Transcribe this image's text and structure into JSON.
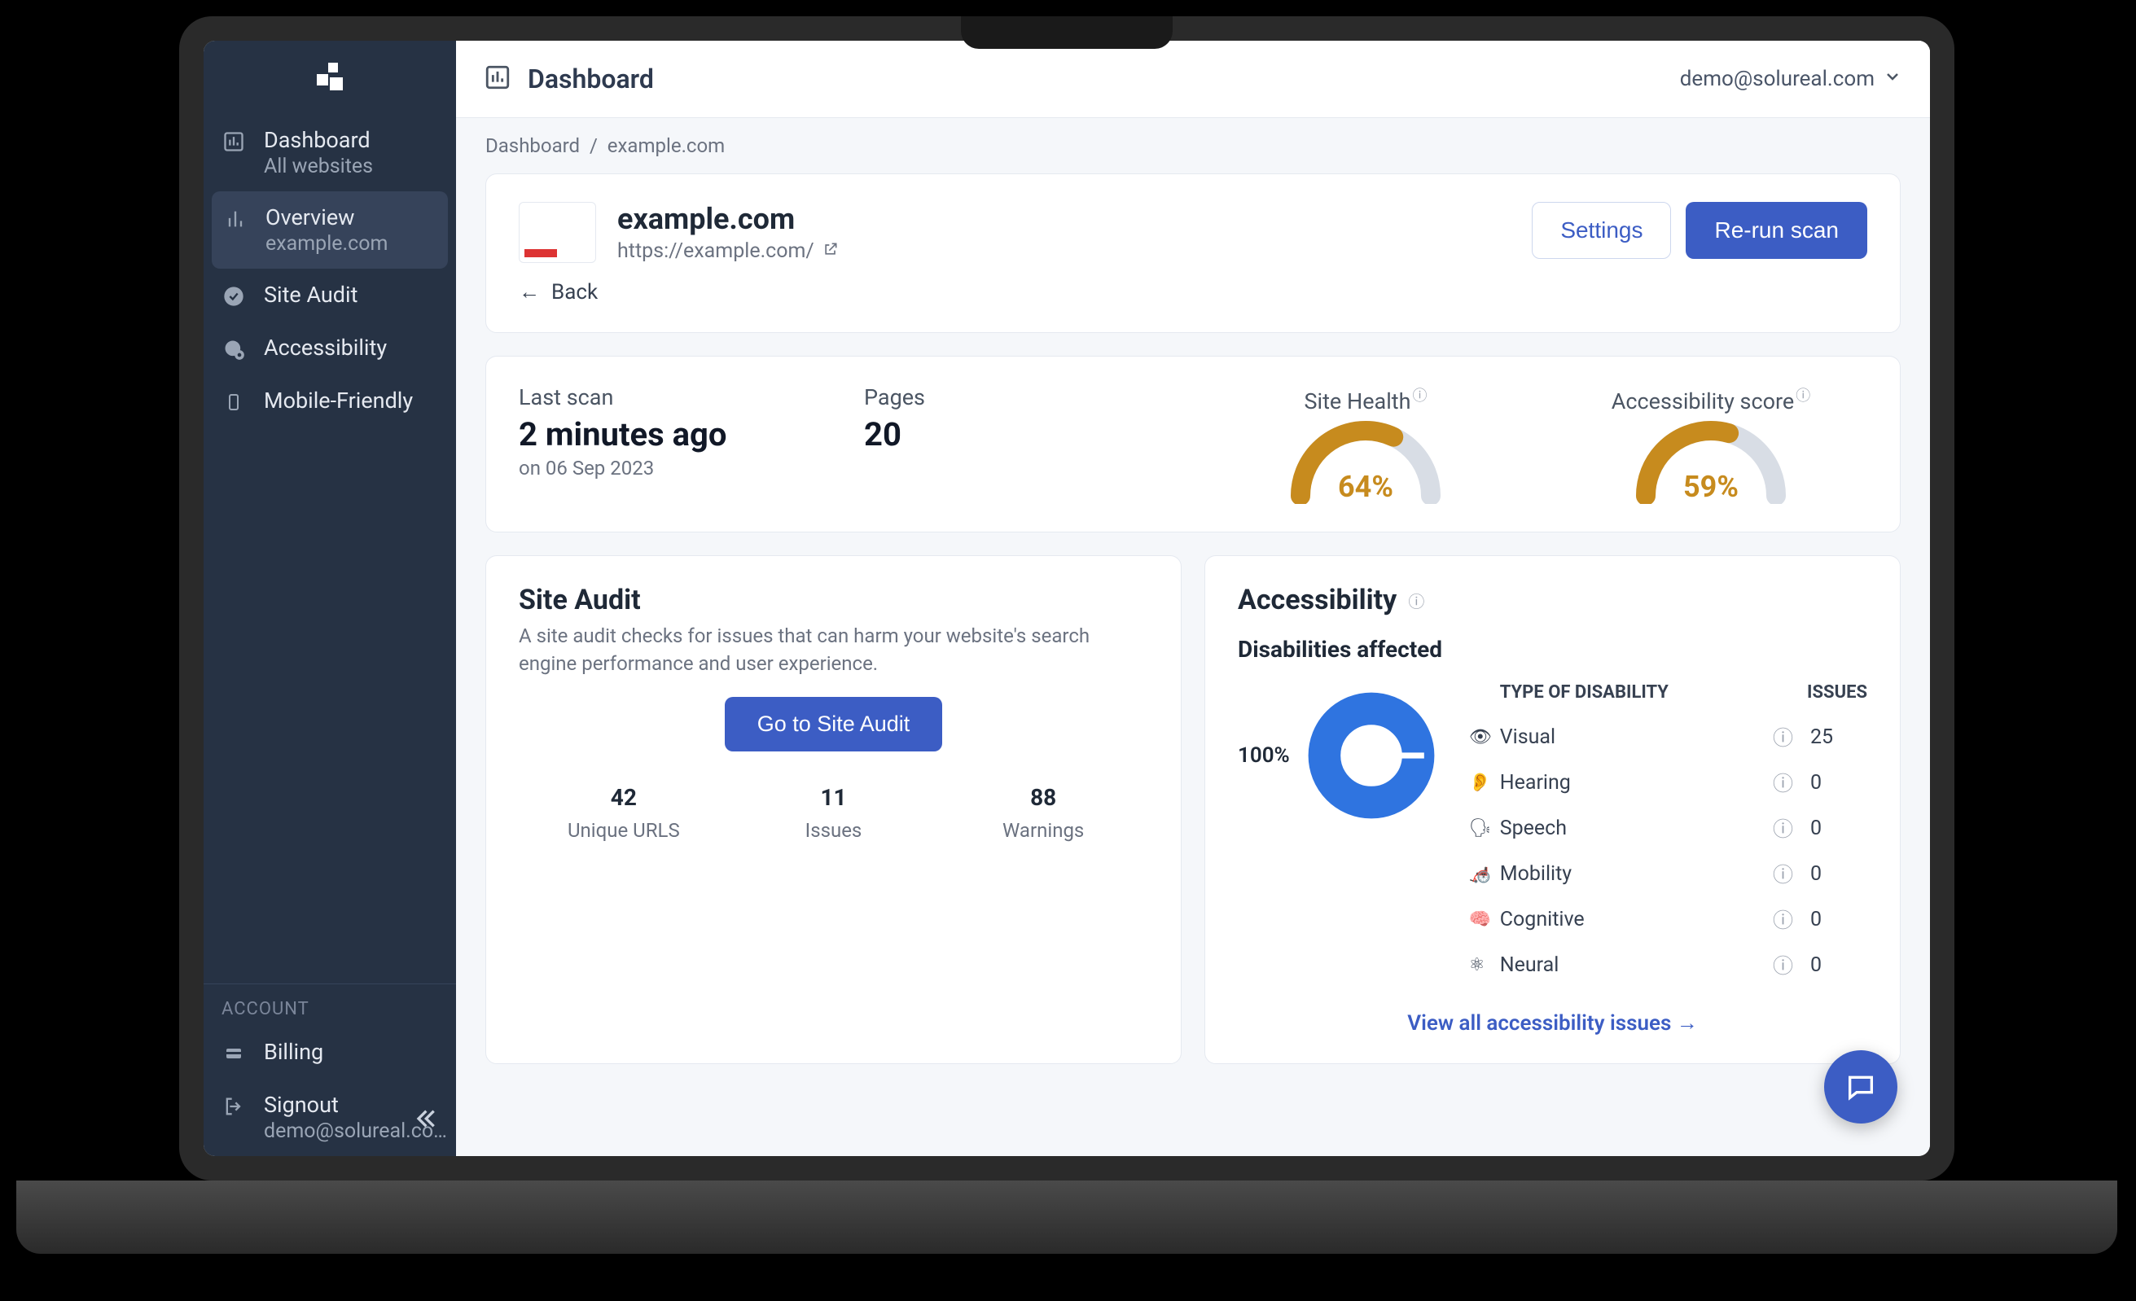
{
  "topbar": {
    "title": "Dashboard",
    "user_email": "demo@solureal.com"
  },
  "breadcrumb": {
    "root": "Dashboard",
    "current": "example.com"
  },
  "sidebar": {
    "dashboard": {
      "label": "Dashboard",
      "sub": "All websites"
    },
    "overview": {
      "label": "Overview",
      "sub": "example.com"
    },
    "site_audit": {
      "label": "Site Audit"
    },
    "accessibility": {
      "label": "Accessibility"
    },
    "mobile": {
      "label": "Mobile-Friendly"
    },
    "account_header": "ACCOUNT",
    "billing": {
      "label": "Billing"
    },
    "signout": {
      "label": "Signout",
      "sub": "demo@solureal.co…"
    }
  },
  "site": {
    "name": "example.com",
    "url": "https://example.com/",
    "settings_label": "Settings",
    "rerun_label": "Re-run scan",
    "back_label": "Back"
  },
  "stats": {
    "last_scan_label": "Last scan",
    "last_scan_value": "2 minutes ago",
    "last_scan_date": "on 06 Sep 2023",
    "pages_label": "Pages",
    "pages_value": "20",
    "site_health_label": "Site Health",
    "site_health_pct": "64%",
    "acc_score_label": "Accessibility score",
    "acc_score_pct": "59%"
  },
  "site_audit_card": {
    "title": "Site Audit",
    "desc": "A site audit checks for issues that can harm your website's search engine performance and user experience.",
    "cta": "Go to Site Audit",
    "metrics": [
      {
        "value": "42",
        "label": "Unique URLS"
      },
      {
        "value": "11",
        "label": "Issues"
      },
      {
        "value": "88",
        "label": "Warnings"
      }
    ]
  },
  "accessibility_card": {
    "title": "Accessibility",
    "subtitle": "Disabilities affected",
    "donut_pct": "100%",
    "table_header_type": "TYPE OF DISABILITY",
    "table_header_issues": "ISSUES",
    "rows": [
      {
        "name": "Visual",
        "issues": "25"
      },
      {
        "name": "Hearing",
        "issues": "0"
      },
      {
        "name": "Speech",
        "issues": "0"
      },
      {
        "name": "Mobility",
        "issues": "0"
      },
      {
        "name": "Cognitive",
        "issues": "0"
      },
      {
        "name": "Neural",
        "issues": "0"
      }
    ],
    "view_all": "View all accessibility issues"
  },
  "chart_data": [
    {
      "type": "bar",
      "title": "Site Health",
      "values": [
        64
      ],
      "ylim": [
        0,
        100
      ],
      "format": "gauge",
      "colors": {
        "value": "#c78b1e",
        "track": "#d8dde5"
      }
    },
    {
      "type": "bar",
      "title": "Accessibility score",
      "values": [
        59
      ],
      "ylim": [
        0,
        100
      ],
      "format": "gauge",
      "colors": {
        "value": "#c78b1e",
        "track": "#d8dde5"
      }
    },
    {
      "type": "pie",
      "title": "Disabilities affected",
      "categories": [
        "Visual",
        "Hearing",
        "Speech",
        "Mobility",
        "Cognitive",
        "Neural"
      ],
      "values": [
        25,
        0,
        0,
        0,
        0,
        0
      ],
      "percent_label": "100%",
      "colors": {
        "primary": "#2f74e0"
      }
    }
  ],
  "colors": {
    "sidebar_bg": "#263244",
    "primary": "#3c5dc4",
    "gauge": "#c78b1e",
    "donut": "#2f74e0"
  }
}
